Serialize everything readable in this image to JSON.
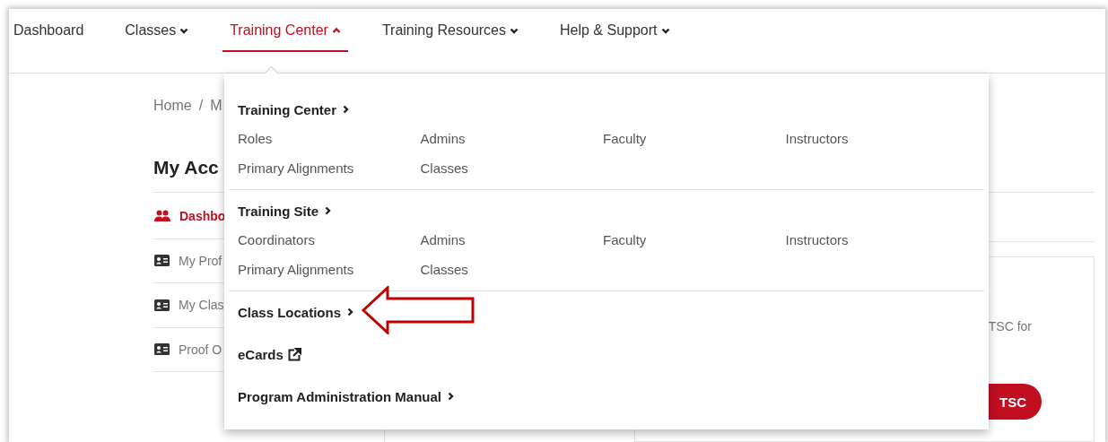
{
  "nav": {
    "items": [
      {
        "label": "Dashboard",
        "kind": "link",
        "selected": false
      },
      {
        "label": "Classes",
        "kind": "menu",
        "selected": false,
        "expanded": false
      },
      {
        "label": "Training Center",
        "kind": "menu",
        "selected": true,
        "expanded": true
      },
      {
        "label": "Training Resources",
        "kind": "menu",
        "selected": false,
        "expanded": false
      },
      {
        "label": "Help & Support",
        "kind": "menu",
        "selected": false,
        "expanded": false
      }
    ]
  },
  "breadcrumb": {
    "items": [
      "Home",
      "M"
    ],
    "separator": "/"
  },
  "page_title": "My Acc",
  "sidebar": {
    "items": [
      {
        "label": "Dashbo",
        "kind": "group",
        "selected": true
      },
      {
        "label": "My Prof",
        "kind": "card",
        "selected": false
      },
      {
        "label": "My Clas",
        "kind": "card",
        "selected": false
      },
      {
        "label": "Proof O",
        "kind": "card",
        "selected": false
      }
    ]
  },
  "card": {
    "text": "TSC for",
    "button": "TSC"
  },
  "dropdown": {
    "sections": [
      {
        "kind": "group",
        "title": "Training Center",
        "links": [
          "Roles",
          "Admins",
          "Faculty",
          "Instructors",
          "Primary Alignments",
          "Classes"
        ]
      },
      {
        "kind": "group",
        "title": "Training Site",
        "links": [
          "Coordinators",
          "Admins",
          "Faculty",
          "Instructors",
          "Primary Alignments",
          "Classes"
        ]
      },
      {
        "kind": "link",
        "title": "Class Locations"
      },
      {
        "kind": "external",
        "title": "eCards"
      },
      {
        "kind": "link",
        "title": "Program Administration Manual"
      }
    ]
  }
}
